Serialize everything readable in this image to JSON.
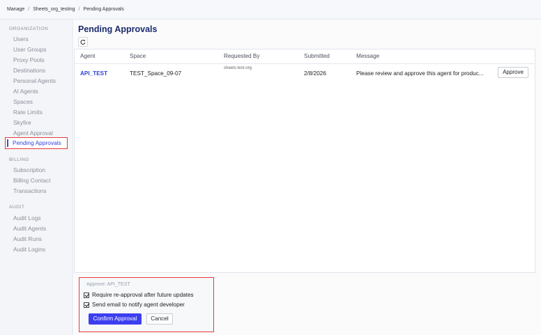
{
  "breadcrumb": {
    "items": [
      "Manage",
      "Sheets_org_testing",
      "Pending Approvals"
    ]
  },
  "sidebar": {
    "organization_title": "ORGANIZATION",
    "organization_items": [
      "Users",
      "User Groups",
      "Proxy Pools",
      "Destinations",
      "Personal Agents",
      "AI Agents",
      "Spaces",
      "Rate Limits",
      "Skyfire",
      "Agent Approval",
      "Pending Approvals"
    ],
    "billing_title": "BILLING",
    "billing_items": [
      "Subscription",
      "Billing Contact",
      "Transactions"
    ],
    "audit_title": "AUDIT",
    "audit_items": [
      "Audit Logs",
      "Audit Agents",
      "Audit Runs",
      "Audit Logins"
    ]
  },
  "main": {
    "title": "Pending Approvals",
    "refresh_icon": "refresh-icon",
    "columns": [
      "Agent",
      "Space",
      "Requested By",
      "Submitted",
      "Message"
    ],
    "row": {
      "agent": "API_TEST",
      "space": "TEST_Space_09-07",
      "requested_by": "sheets-test-org",
      "submitted": "2/8/2026",
      "message": "Please review and approve this agent for produc...",
      "approve_label": "Approve"
    }
  },
  "approval_panel": {
    "heading": "Approve: API_TEST",
    "reapproval_label": "Require re-approval after future updates",
    "reapproval_checked": true,
    "email_label": "Send email to notify agent developer",
    "email_checked": true,
    "confirm_label": "Confirm Approval",
    "cancel_label": "Cancel"
  },
  "colors": {
    "accent": "#3b3ff0",
    "highlight_border": "#e33a3a"
  }
}
